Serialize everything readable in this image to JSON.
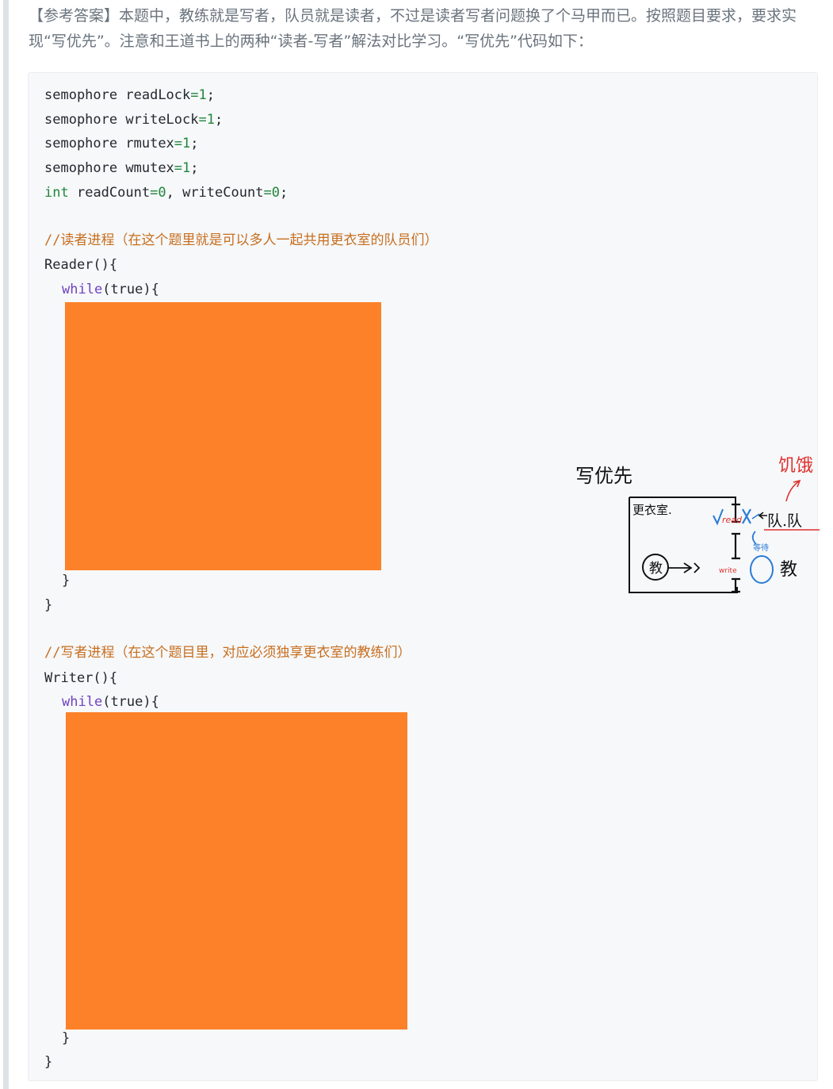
{
  "intro": "【参考答案】本题中，教练就是写者，队员就是读者，不过是读者写者问题换了个马甲而已。按照题目要求，要求实现“写优先”。注意和王道书上的两种“读者-写者”解法对比学习。“写优先”代码如下：",
  "code": {
    "decls": [
      {
        "type": "semophore",
        "name": "readLock",
        "op": "=",
        "value": "1",
        "end": ";"
      },
      {
        "type": "semophore",
        "name": "writeLock",
        "op": "=",
        "value": "1",
        "end": ";"
      },
      {
        "type": "semophore",
        "name": "rmutex",
        "op": "=",
        "value": "1",
        "end": ";"
      },
      {
        "type": "semophore",
        "name": "wmutex",
        "op": "=",
        "value": "1",
        "end": ";"
      }
    ],
    "int_line": {
      "type": "int",
      "name1": "readCount",
      "value1": "0",
      "sep": ", ",
      "name2": "writeCount",
      "value2": "0",
      "end": ";"
    },
    "reader_comment": "//读者进程（在这个题里就是可以多人一起共用更衣室的队员们）",
    "reader_func": "Reader",
    "writer_comment": "//写者进程（在这个题目里，对应必须独享更衣室的教练们）",
    "writer_func": "Writer",
    "while_kw": "while",
    "true_kw": "true",
    "paren_open": "(",
    "paren_close": ")",
    "brace_open": "{",
    "brace_close": "}",
    "eq": "=",
    "empty_parens": "()"
  },
  "sketch": {
    "title": "写优先",
    "room_label": "更衣室.",
    "coach_inside": "教",
    "read_label": "read",
    "write_label": "write",
    "players": "队.队",
    "coach_outside": "教",
    "hunger_note": "饥饿",
    "blue_note": "等待"
  },
  "colors": {
    "redaction": "#fd8128",
    "comment": "#c86e1e",
    "keyword": "#6f42c1",
    "number": "#22863a",
    "sketch_red": "#e0302c",
    "sketch_blue": "#2a7bd6"
  }
}
